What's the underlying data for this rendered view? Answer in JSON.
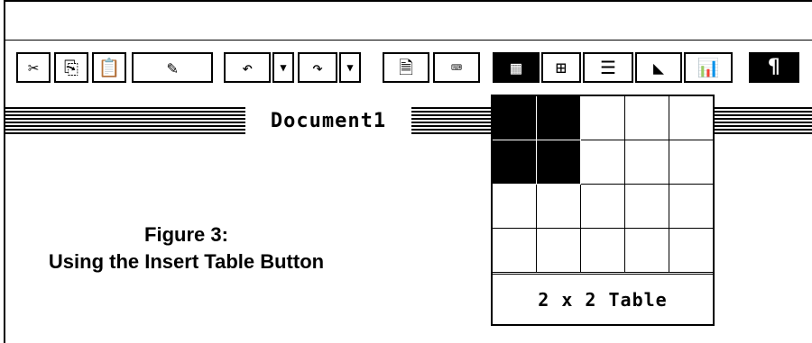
{
  "window": {
    "title": "Document1"
  },
  "toolbar": {
    "cut_icon": "✂",
    "copy_icon": "⎘",
    "paste_icon": "📋",
    "format_painter_icon": "✎",
    "undo_icon": "↶",
    "redo_icon": "↷",
    "dropdown_arrow": "▼",
    "new_icon": "🗎",
    "keyboard_icon": "⌨",
    "insert_table_icon": "▦",
    "database_icon": "⊞",
    "columns_icon": "☰",
    "drawing_icon": "◣",
    "chart_icon": "📊",
    "paragraph_icon": "¶"
  },
  "table_picker": {
    "rows": 4,
    "columns": 5,
    "selected_rows": 2,
    "selected_columns": 2,
    "status": "2 x 2 Table"
  },
  "caption": {
    "line1": "Figure 3:",
    "line2": "Using the Insert Table Button"
  }
}
